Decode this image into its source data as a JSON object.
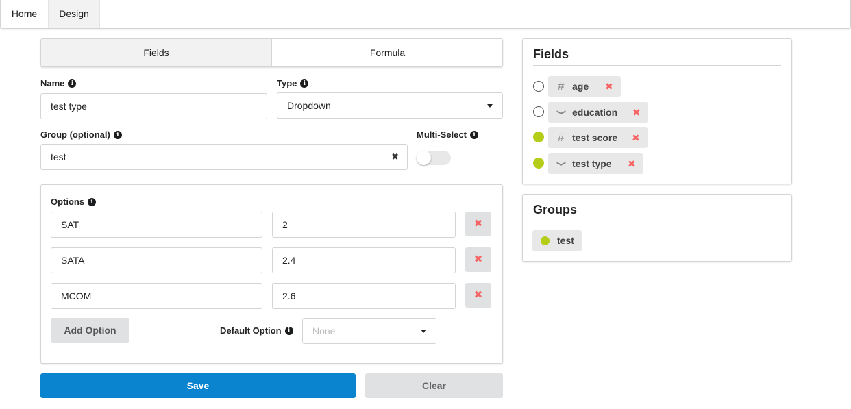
{
  "nav": {
    "tabs": [
      {
        "label": "Home"
      },
      {
        "label": "Design"
      }
    ]
  },
  "editor": {
    "segments": {
      "fields": "Fields",
      "formula": "Formula"
    },
    "name": {
      "label": "Name",
      "value": "test type"
    },
    "type": {
      "label": "Type",
      "value": "Dropdown"
    },
    "group": {
      "label": "Group (optional)",
      "value": "test"
    },
    "multi_select": {
      "label": "Multi-Select",
      "on": false
    },
    "options": {
      "label": "Options",
      "rows": [
        {
          "name": "SAT",
          "value": "2"
        },
        {
          "name": "SATA",
          "value": "2.4"
        },
        {
          "name": "MCOM",
          "value": "2.6"
        }
      ],
      "add_label": "Add Option",
      "default_label": "Default Option",
      "default_placeholder": "None"
    },
    "save_label": "Save",
    "clear_label": "Clear"
  },
  "fields_panel": {
    "title": "Fields",
    "items": [
      {
        "label": "age",
        "icon": "hash-icon",
        "selected": false
      },
      {
        "label": "education",
        "icon": "chevron-down-icon",
        "selected": false
      },
      {
        "label": "test score",
        "icon": "hash-icon",
        "selected": true
      },
      {
        "label": "test type",
        "icon": "chevron-down-icon",
        "selected": true
      }
    ]
  },
  "groups_panel": {
    "title": "Groups",
    "items": [
      {
        "label": "test"
      }
    ]
  },
  "colors": {
    "primary": "#0a84cf",
    "selected_dot": "#b5cc18",
    "delete": "#f56565"
  }
}
